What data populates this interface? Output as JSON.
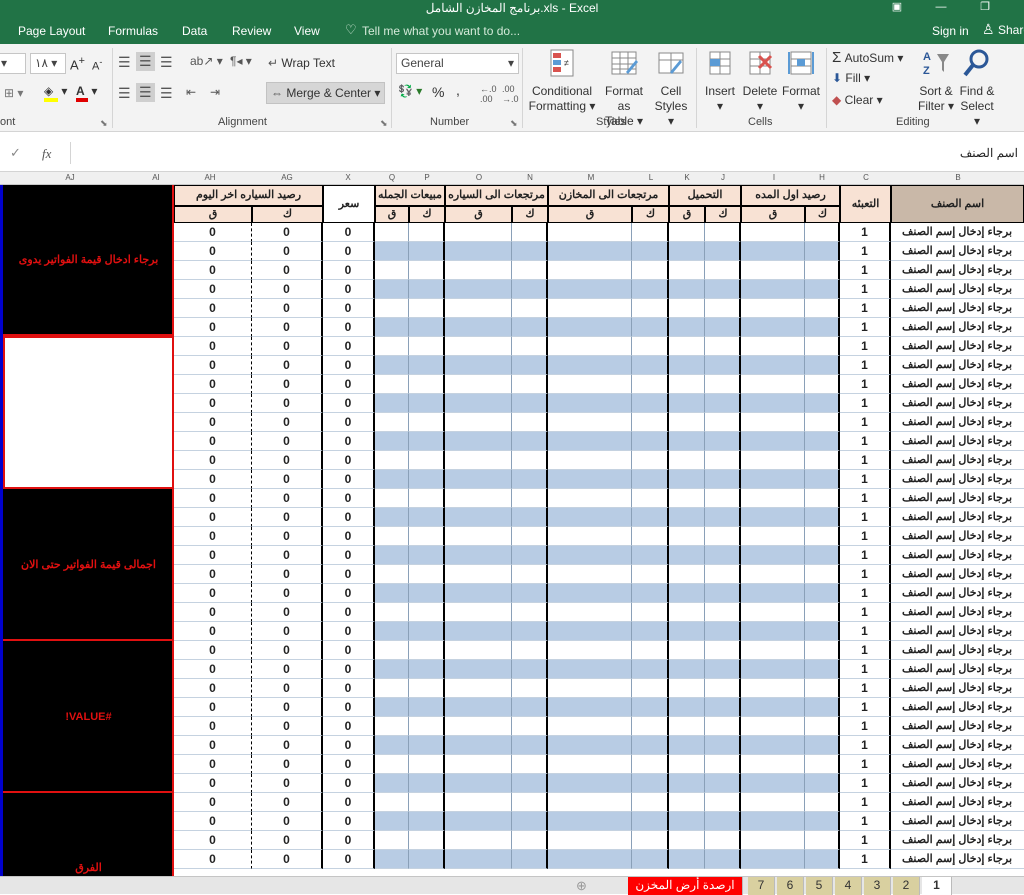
{
  "window": {
    "title": "برنامج المخازن الشامل.xls - Excel"
  },
  "ribbon_tabs": [
    "Page Layout",
    "Formulas",
    "Data",
    "Review",
    "View"
  ],
  "tell_me": "Tell me what you want to do...",
  "sign_in": "Sign in",
  "share": "Share",
  "font": {
    "size": "١٨",
    "group_label": "ont"
  },
  "alignment": {
    "wrap_text": "Wrap Text",
    "merge_center": "Merge & Center",
    "group_label": "Alignment"
  },
  "number": {
    "format": "General",
    "percent": "%",
    "comma": ",",
    "group_label": "Number"
  },
  "styles": {
    "conditional_1": "Conditional",
    "conditional_2": "Formatting",
    "format_as_1": "Format as",
    "format_as_2": "Table",
    "cell_styles_1": "Cell",
    "cell_styles_2": "Styles",
    "group_label": "Styles"
  },
  "cells": {
    "insert": "Insert",
    "delete": "Delete",
    "format": "Format",
    "group_label": "Cells"
  },
  "editing": {
    "autosum": "AutoSum",
    "fill": "Fill",
    "clear": "Clear",
    "sort_1": "Sort &",
    "sort_2": "Filter",
    "find_1": "Find &",
    "find_2": "Select",
    "group_label": "Editing"
  },
  "formula_bar": {
    "fx": "fx",
    "value": "اسم الصنف"
  },
  "col_letters": [
    "AJ",
    "AI",
    "AH",
    "AG",
    "X",
    "Q",
    "P",
    "O",
    "N",
    "M",
    "L",
    "K",
    "J",
    "I",
    "H",
    "C",
    "B"
  ],
  "headers": {
    "car_balance": "رصيد السياره اخر اليوم",
    "wholesale_price": "سعر الجملة",
    "wholesale_sales": "مبيعات الجمله",
    "car_returns": "مرتجعات الى السياره",
    "store_returns": "مرتجعات الى المخازن",
    "loading": "التحميل",
    "opening_balance": "رصيد اول المده",
    "packing": "التعبئه",
    "item_name": "اسم الصنف",
    "q": "ق",
    "k": "ك"
  },
  "rows": {
    "item_name": "برجاء إدخال إسم الصنف",
    "packing": "1",
    "ah": "0",
    "ag": "0",
    "x": "0",
    "count": 34
  },
  "side_blocks": {
    "b1": "برجاء ادخال قيمة الفواتير يدوى",
    "b2": "اجمالى قيمة الفواتير حتى الان",
    "b3": "#VALUE!",
    "b4": "الفرق"
  },
  "sheet_tabs": [
    "ارصدة أرض المخزن",
    "7",
    "6",
    "5",
    "4",
    "3",
    "2",
    "1"
  ],
  "colors": {
    "accent": "#217346",
    "header_fill": "#f8e2d4",
    "band_fill": "#b8cce4",
    "error_red": "#e01010"
  }
}
